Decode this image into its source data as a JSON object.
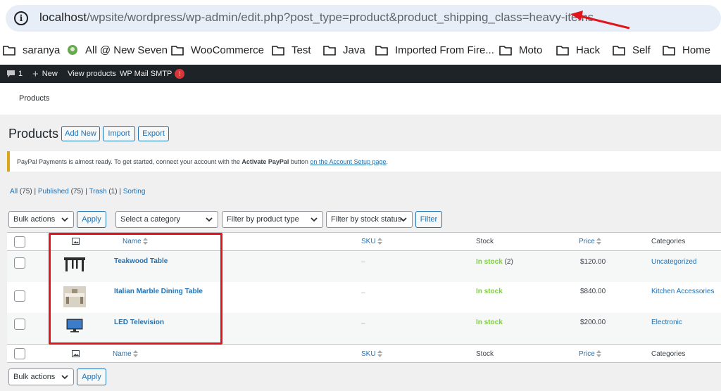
{
  "browser": {
    "url_host": "localhost",
    "url_path": "/wpsite/wordpress/wp-admin/edit.php?post_type=product&product_shipping_class=heavy-items",
    "bookmarks": [
      "saranya",
      "All @ New Seven",
      "WooCommerce",
      "Test",
      "Java",
      "Imported From Fire...",
      "Moto",
      "Hack",
      "Self",
      "Home"
    ]
  },
  "adminbar": {
    "comments_count": "1",
    "new_label": "New",
    "view_products": "View products",
    "wp_mail_smtp": "WP Mail SMTP",
    "smtp_badge": "!"
  },
  "wc_header": {
    "title": "Products"
  },
  "page": {
    "title": "Products",
    "add_new": "Add New",
    "import": "Import",
    "export": "Export"
  },
  "notice": {
    "text_before": "PayPal Payments is almost ready. To get started, connect your account with the ",
    "bold": "Activate PayPal",
    "text_mid": " button ",
    "link": "on the Account Setup page",
    "text_after": "."
  },
  "filters_views": {
    "all": "All",
    "all_count": "(75)",
    "published": "Published",
    "published_count": "(75)",
    "trash": "Trash",
    "trash_count": "(1)",
    "sorting": "Sorting"
  },
  "toolbar": {
    "bulk_actions": "Bulk actions",
    "apply": "Apply",
    "category": "Select a category",
    "product_type": "Filter by product type",
    "stock_status": "Filter by stock status",
    "filter": "Filter"
  },
  "table": {
    "columns": {
      "name": "Name",
      "sku": "SKU",
      "stock": "Stock",
      "price": "Price",
      "categories": "Categories"
    },
    "rows": [
      {
        "name": "Teakwood Table",
        "sku": "–",
        "stock": "In stock",
        "stock_qty": " (2)",
        "price": "$120.00",
        "category": "Uncategorized"
      },
      {
        "name": "Italian Marble Dining Table",
        "sku": "–",
        "stock": "In stock",
        "stock_qty": "",
        "price": "$840.00",
        "category": "Kitchen Accessories"
      },
      {
        "name": "LED Television",
        "sku": "–",
        "stock": "In stock",
        "stock_qty": "",
        "price": "$200.00",
        "category": "Electronic"
      }
    ]
  },
  "colors": {
    "accent": "#2271b1",
    "in_stock": "#7ad03a",
    "annotation": "#e1141b",
    "adminbar": "#1d2327"
  }
}
